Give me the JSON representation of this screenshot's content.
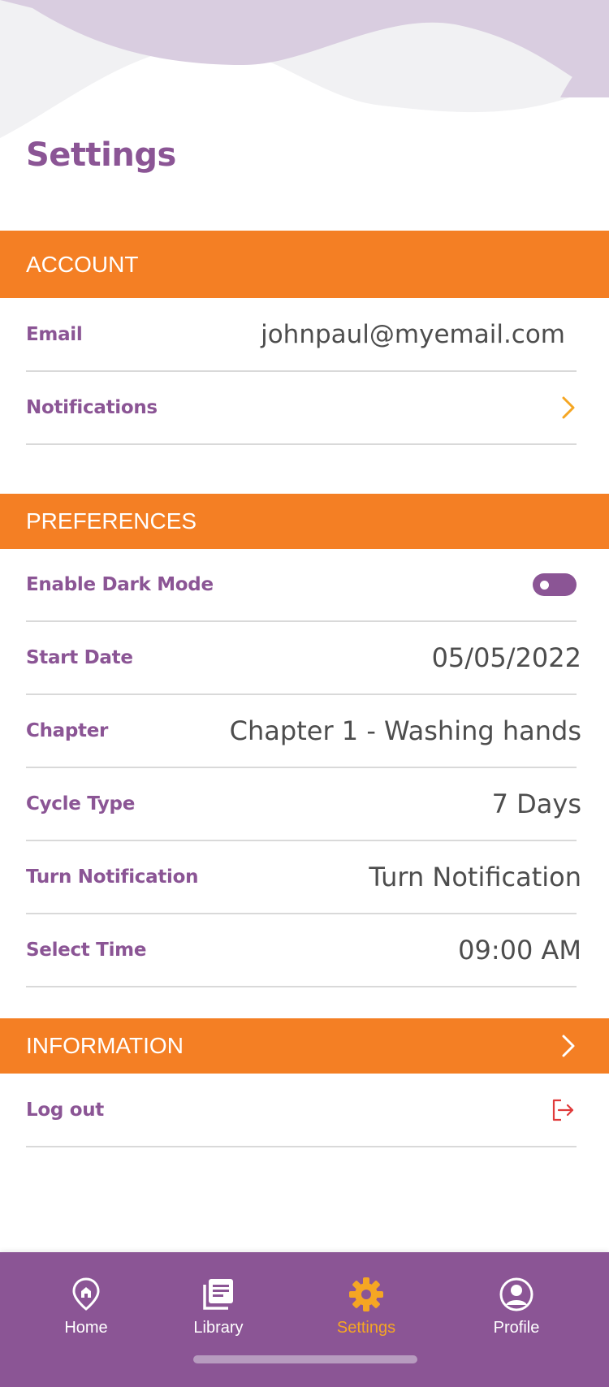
{
  "page": {
    "title": "Settings"
  },
  "account": {
    "header": "ACCOUNT",
    "email_label": "Email",
    "email_value": "johnpaul@myemail.com",
    "notifications_label": "Notifications"
  },
  "preferences": {
    "header": "PREFERENCES",
    "dark_mode_label": "Enable Dark Mode",
    "dark_mode_enabled": false,
    "start_date_label": "Start Date",
    "start_date_value": "05/05/2022",
    "chapter_label": "Chapter",
    "chapter_value": "Chapter 1 - Washing hands",
    "cycle_type_label": "Cycle Type",
    "cycle_type_value": "7 Days",
    "turn_notification_label": "Turn Notification",
    "turn_notification_value": "Turn Notification",
    "select_time_label": "Select Time",
    "select_time_value": "09:00 AM"
  },
  "information": {
    "header": "INFORMATION"
  },
  "logout": {
    "label": "Log out",
    "icon": "logout-icon"
  },
  "nav": {
    "items": [
      {
        "label": "Home",
        "icon": "map-pin-icon"
      },
      {
        "label": "Library",
        "icon": "library-icon"
      },
      {
        "label": "Settings",
        "icon": "gear-icon",
        "active": true
      },
      {
        "label": "Profile",
        "icon": "user-circle-icon"
      }
    ]
  },
  "colors": {
    "brand_purple": "#8b5595",
    "accent_orange": "#f47f24",
    "active_tab": "#f5a623",
    "logout_red": "#e03a3a"
  }
}
